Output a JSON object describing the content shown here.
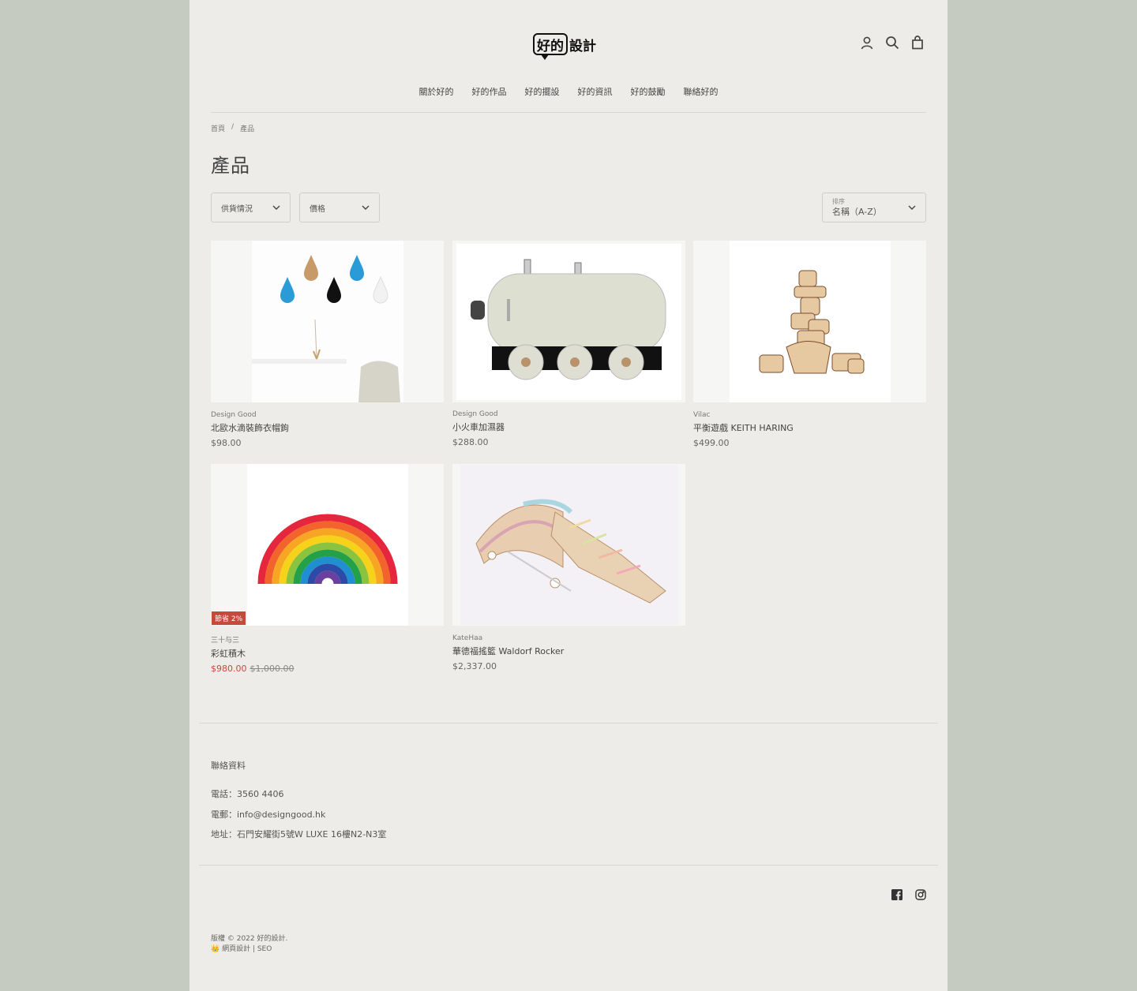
{
  "brand": {
    "logo_bubble": "好的",
    "logo_rest": "設計"
  },
  "header_icons": [
    "account-icon",
    "search-icon",
    "cart-icon"
  ],
  "nav": [
    {
      "label": "關於好的"
    },
    {
      "label": "好的作品"
    },
    {
      "label": "好的擺設"
    },
    {
      "label": "好的資訊"
    },
    {
      "label": "好的鼓勵"
    },
    {
      "label": "聯絡好的"
    }
  ],
  "breadcrumb": {
    "home": "首頁",
    "separator": "/",
    "current": "產品"
  },
  "page_title": "產品",
  "filters": {
    "availability": "供貨情況",
    "price": "價格",
    "sort_label": "排序",
    "sort_value": "名稱（A-Z）"
  },
  "products": [
    {
      "vendor": "Design Good",
      "title": "北歐水滴裝飾衣帽鉤",
      "price": "$98.00"
    },
    {
      "vendor": "Design Good",
      "title": "小火車加濕器",
      "price": "$288.00"
    },
    {
      "vendor": "Vilac",
      "title": "平衡遊戲 KEITH HARING",
      "price": "$499.00"
    },
    {
      "vendor": "三十与三",
      "title": "彩虹積木",
      "price": "$980.00",
      "compare_price": "$1,000.00",
      "badge": "節省 2%"
    },
    {
      "vendor": "KateHaa",
      "title": "華德福搖籃 Waldorf Rocker",
      "price": "$2,337.00"
    }
  ],
  "footer": {
    "contact_title": "聯絡資料",
    "phone": "電話：3560 4406",
    "email": "電郵：info@designgood.hk",
    "address": "地址：石門安耀街5號W LUXE 16樓N2-N3室",
    "copyright": "版權 © 2022 好的設計.",
    "credit": "👑 網頁設計 | SEO"
  },
  "social": [
    "facebook-icon",
    "instagram-icon"
  ],
  "colors": {
    "page_bg": "#edece8",
    "outer_bg": "#c5cbc0",
    "sale": "#c44b3c"
  }
}
